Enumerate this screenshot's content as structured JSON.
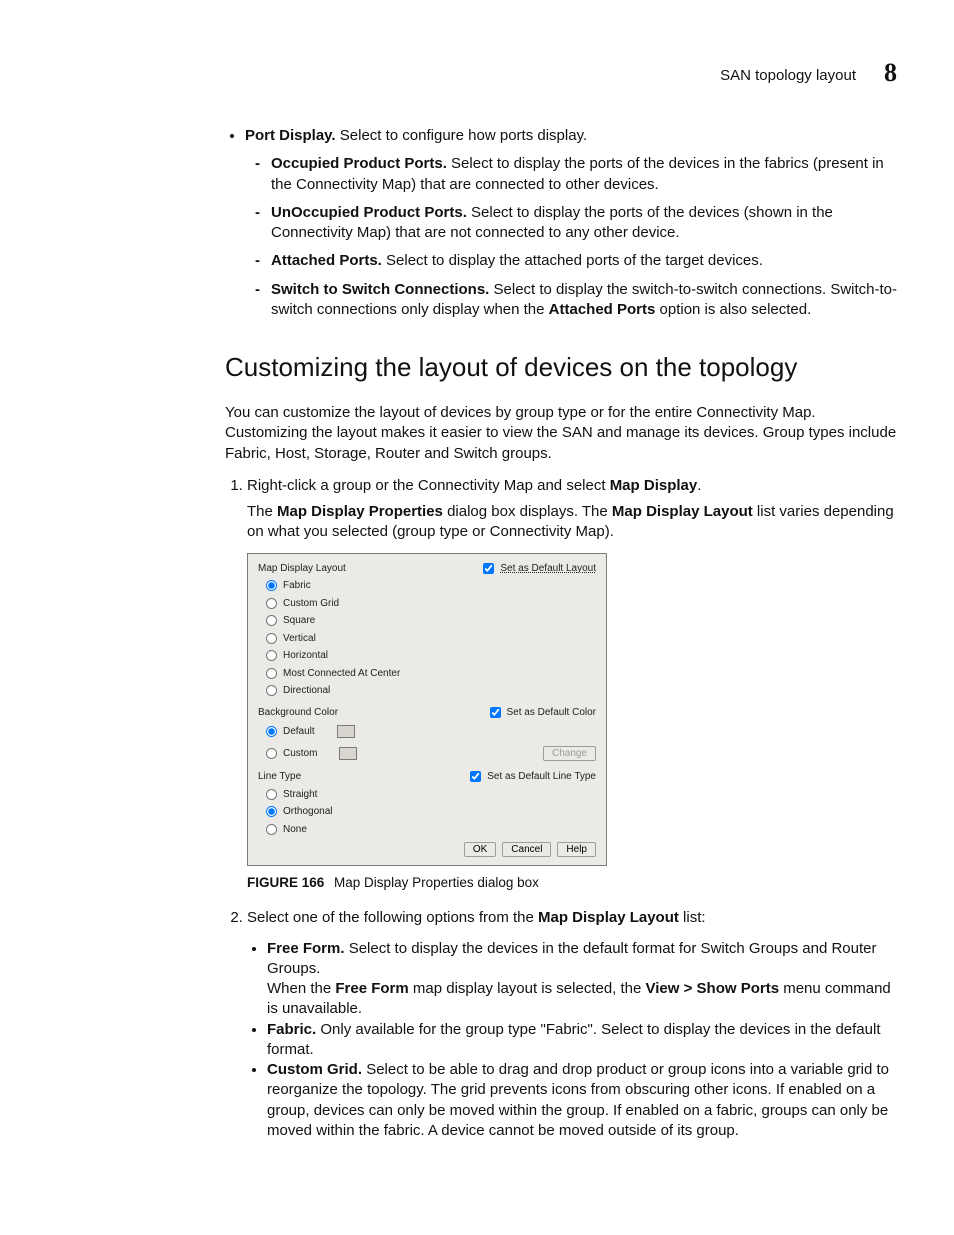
{
  "header": {
    "title": "SAN topology layout",
    "chapter_number": "8"
  },
  "bullets": {
    "port_display": {
      "term": "Port Display.",
      "desc": "Select to configure how ports display.",
      "subs": [
        {
          "term": "Occupied Product Ports.",
          "desc": "Select to display the ports of the devices in the fabrics (present in the Connectivity Map) that are connected to other devices."
        },
        {
          "term": "UnOccupied Product Ports.",
          "desc": "Select to display the ports of the devices (shown in the Connectivity Map) that are not connected to any other device."
        },
        {
          "term": "Attached Ports.",
          "desc": "Select to display the attached ports of the target devices."
        },
        {
          "term": "Switch to Switch Connections.",
          "desc_pre": "Select to display the switch-to-switch connections. Switch-to-switch connections only display when the ",
          "desc_bold": "Attached Ports",
          "desc_post": " option is also selected."
        }
      ]
    }
  },
  "section": {
    "heading": "Customizing the layout of devices on the topology",
    "intro": "You can customize the layout of devices by group type or for the entire Connectivity Map. Customizing the layout makes it easier to view the SAN and manage its devices. Group types include Fabric, Host, Storage, Router and Switch groups.",
    "step1": {
      "text_pre": "Right-click a group or the Connectivity Map and select ",
      "bold": "Map Display",
      "text_post": ".",
      "body_pre": "The ",
      "bold1": "Map Display Properties",
      "mid1": " dialog box displays. The ",
      "bold2": "Map Display Layout",
      "mid2": " list varies depending on what you selected (group type or Connectivity Map)."
    },
    "figure": {
      "label": "FIGURE 166",
      "caption": "Map Display Properties dialog box"
    },
    "step2": {
      "text_pre": "Select one of the following options from the ",
      "bold": "Map Display Layout",
      "text_post": " list:",
      "items": [
        {
          "term": "Free Form.",
          "desc_pre": "Select to display the devices in the default format for Switch Groups and Router Groups.",
          "line2_pre": "When the ",
          "line2_b1": "Free Form",
          "line2_mid": " map display layout is selected, the ",
          "line2_b2": "View > Show Ports",
          "line2_post": " menu command is unavailable."
        },
        {
          "term": "Fabric.",
          "desc": "Only available for the group type \"Fabric\". Select to display the devices in the default format."
        },
        {
          "term": "Custom Grid.",
          "desc": "Select to be able to drag and drop product or group icons into a variable grid to reorganize the topology. The grid prevents icons from obscuring other icons. If enabled on a group, devices can only be moved within the group. If enabled on a fabric, groups can only be moved within the fabric. A device cannot be moved outside of its group."
        }
      ]
    }
  },
  "dialog": {
    "layout_label": "Map Display Layout",
    "set_default_layout": "Set as Default Layout",
    "layout_options": [
      "Fabric",
      "Custom Grid",
      "Square",
      "Vertical",
      "Horizontal",
      "Most Connected At Center",
      "Directional"
    ],
    "bg_label": "Background Color",
    "set_default_color": "Set as Default Color",
    "bg_options": [
      "Default",
      "Custom"
    ],
    "change_btn": "Change",
    "line_label": "Line Type",
    "set_default_line": "Set as Default Line Type",
    "line_options": [
      "Straight",
      "Orthogonal",
      "None"
    ],
    "buttons": {
      "ok": "OK",
      "cancel": "Cancel",
      "help": "Help"
    }
  }
}
